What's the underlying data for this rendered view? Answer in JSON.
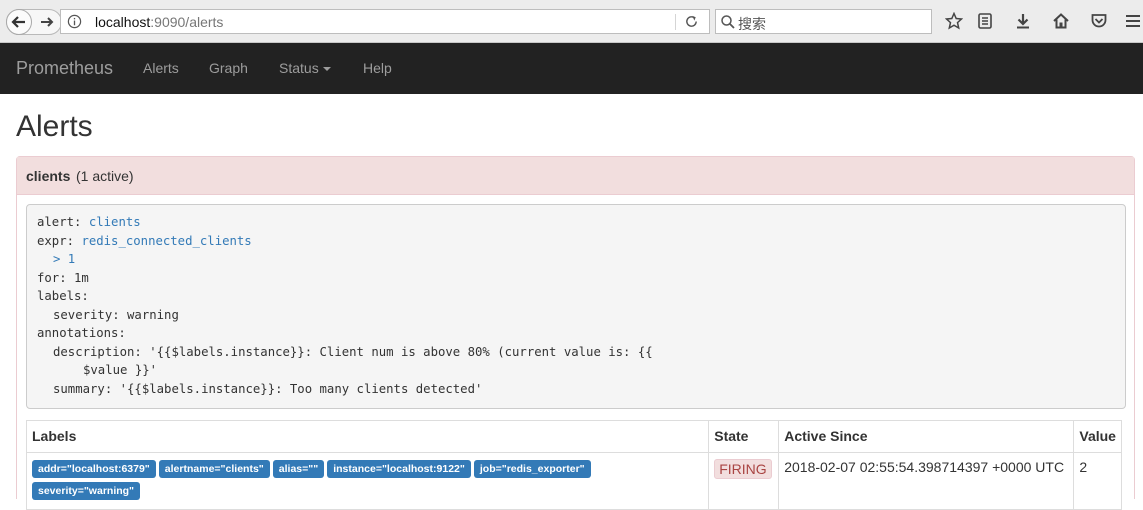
{
  "browser": {
    "url_host": "localhost",
    "url_rest": ":9090/alerts",
    "search_placeholder": "搜索",
    "icons": [
      "back-icon",
      "forward-icon",
      "info-icon",
      "reload-icon",
      "search-icon",
      "bookmark-star-icon",
      "reading-list-icon",
      "download-icon",
      "home-icon",
      "pocket-icon",
      "menu-icon"
    ]
  },
  "navbar": {
    "brand": "Prometheus",
    "links": [
      "Alerts",
      "Graph",
      "Status",
      "Help"
    ]
  },
  "page": {
    "title": "Alerts"
  },
  "alert_group": {
    "name": "clients",
    "count_text": "(1 active)",
    "rule": {
      "alert_key": "alert:",
      "alert_value": "clients",
      "expr_key": "expr:",
      "expr_value": "redis_connected_clients",
      "expr_cont": "> 1",
      "for_line": "for: 1m",
      "labels_key": "labels:",
      "severity_line": "severity: warning",
      "annotations_key": "annotations:",
      "description_line1": "description: '{{$labels.instance}}: Client num is above 80% (current value is: {{",
      "description_line2": "$value }}'",
      "summary_line": "summary: '{{$labels.instance}}: Too many clients detected'"
    },
    "table": {
      "headers": [
        "Labels",
        "State",
        "Active Since",
        "Value"
      ],
      "rows": [
        {
          "labels": [
            "addr=\"localhost:6379\"",
            "alertname=\"clients\"",
            "alias=\"\"",
            "instance=\"localhost:9122\"",
            "job=\"redis_exporter\"",
            "severity=\"warning\""
          ],
          "state": "FIRING",
          "active_since": "2018-02-07 02:55:54.398714397 +0000 UTC",
          "value": "2"
        }
      ]
    }
  },
  "colors": {
    "navbar_bg": "#222222",
    "panel_head_bg": "#f2dede",
    "label_badge": "#337ab7",
    "firing_text": "#a94442"
  }
}
